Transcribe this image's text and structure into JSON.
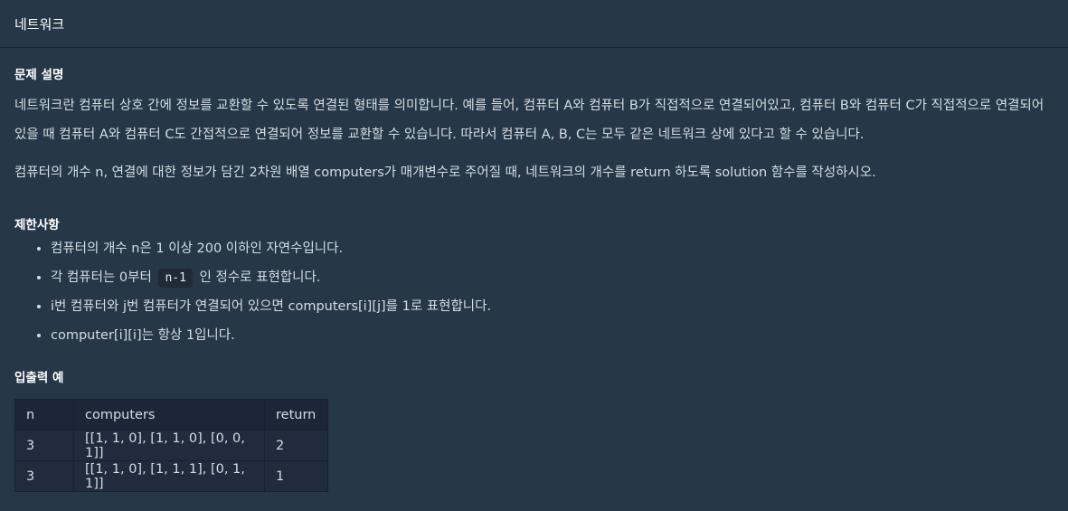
{
  "header": {
    "title": "네트워크"
  },
  "description": {
    "heading": "문제 설명",
    "paragraph1": "네트워크란 컴퓨터 상호 간에 정보를 교환할 수 있도록 연결된 형태를 의미합니다. 예를 들어, 컴퓨터 A와 컴퓨터 B가 직접적으로 연결되어있고, 컴퓨터 B와 컴퓨터 C가 직접적으로 연결되어 있을 때 컴퓨터 A와 컴퓨터 C도 간접적으로 연결되어 정보를 교환할 수 있습니다. 따라서 컴퓨터 A, B, C는 모두 같은 네트워크 상에 있다고 할 수 있습니다.",
    "paragraph2": "컴퓨터의 개수 n, 연결에 대한 정보가 담긴 2차원 배열 computers가 매개변수로 주어질 때, 네트워크의 개수를 return 하도록 solution 함수를 작성하시오."
  },
  "constraints": {
    "heading": "제한사항",
    "item1": "컴퓨터의 개수 n은 1 이상 200 이하인 자연수입니다.",
    "item2_before": "각 컴퓨터는 0부터",
    "item2_code": "n-1",
    "item2_after": "인 정수로 표현합니다.",
    "item3": "i번 컴퓨터와 j번 컴퓨터가 연결되어 있으면 computers[i][j]를 1로 표현합니다.",
    "item4": "computer[i][i]는 항상 1입니다."
  },
  "examples": {
    "heading": "입출력 예",
    "columns": [
      "n",
      "computers",
      "return"
    ],
    "rows": [
      [
        "3",
        "[[1, 1, 0], [1, 1, 0], [0, 0, 1]]",
        "2"
      ],
      [
        "3",
        "[[1, 1, 0], [1, 1, 1], [0, 1, 1]]",
        "1"
      ]
    ]
  }
}
